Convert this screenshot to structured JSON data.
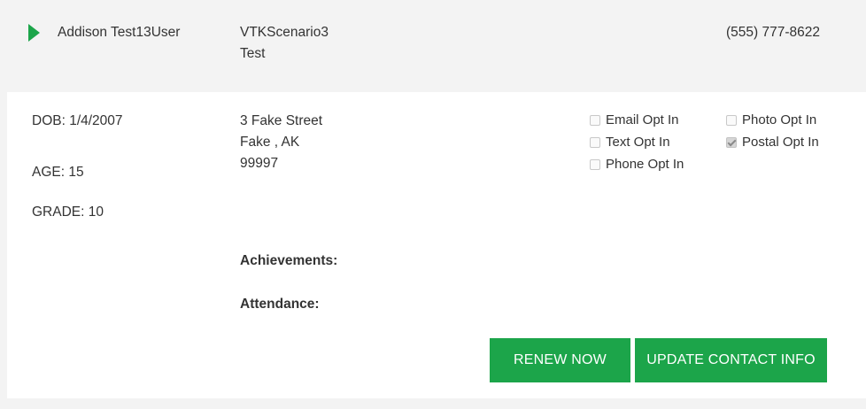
{
  "header": {
    "student_name": "Addison Test13User",
    "program_line1": "VTKScenario3",
    "program_line2": "Test",
    "phone": "(555) 777-8622"
  },
  "details": {
    "dob": "DOB: 1/4/2007",
    "age": "AGE: 15",
    "grade": "GRADE: 10",
    "address_line1": "3 Fake Street",
    "address_line2": "Fake , AK",
    "address_line3": "99997",
    "achievements_label": "Achievements:",
    "attendance_label": "Attendance:"
  },
  "opt_ins": {
    "email": {
      "label": "Email Opt In",
      "checked": false
    },
    "text": {
      "label": "Text Opt In",
      "checked": false
    },
    "phone": {
      "label": "Phone Opt In",
      "checked": false
    },
    "photo": {
      "label": "Photo Opt In",
      "checked": false
    },
    "postal": {
      "label": "Postal Opt In",
      "checked": true
    }
  },
  "buttons": {
    "renew": "RENEW NOW",
    "update_contact": "UPDATE CONTACT INFO"
  },
  "colors": {
    "accent": "#1ca54a",
    "background": "#f3f3f3",
    "panel": "#ffffff"
  },
  "icons": {
    "expand": "caret-right-icon",
    "checkbox": "checkbox-icon"
  }
}
